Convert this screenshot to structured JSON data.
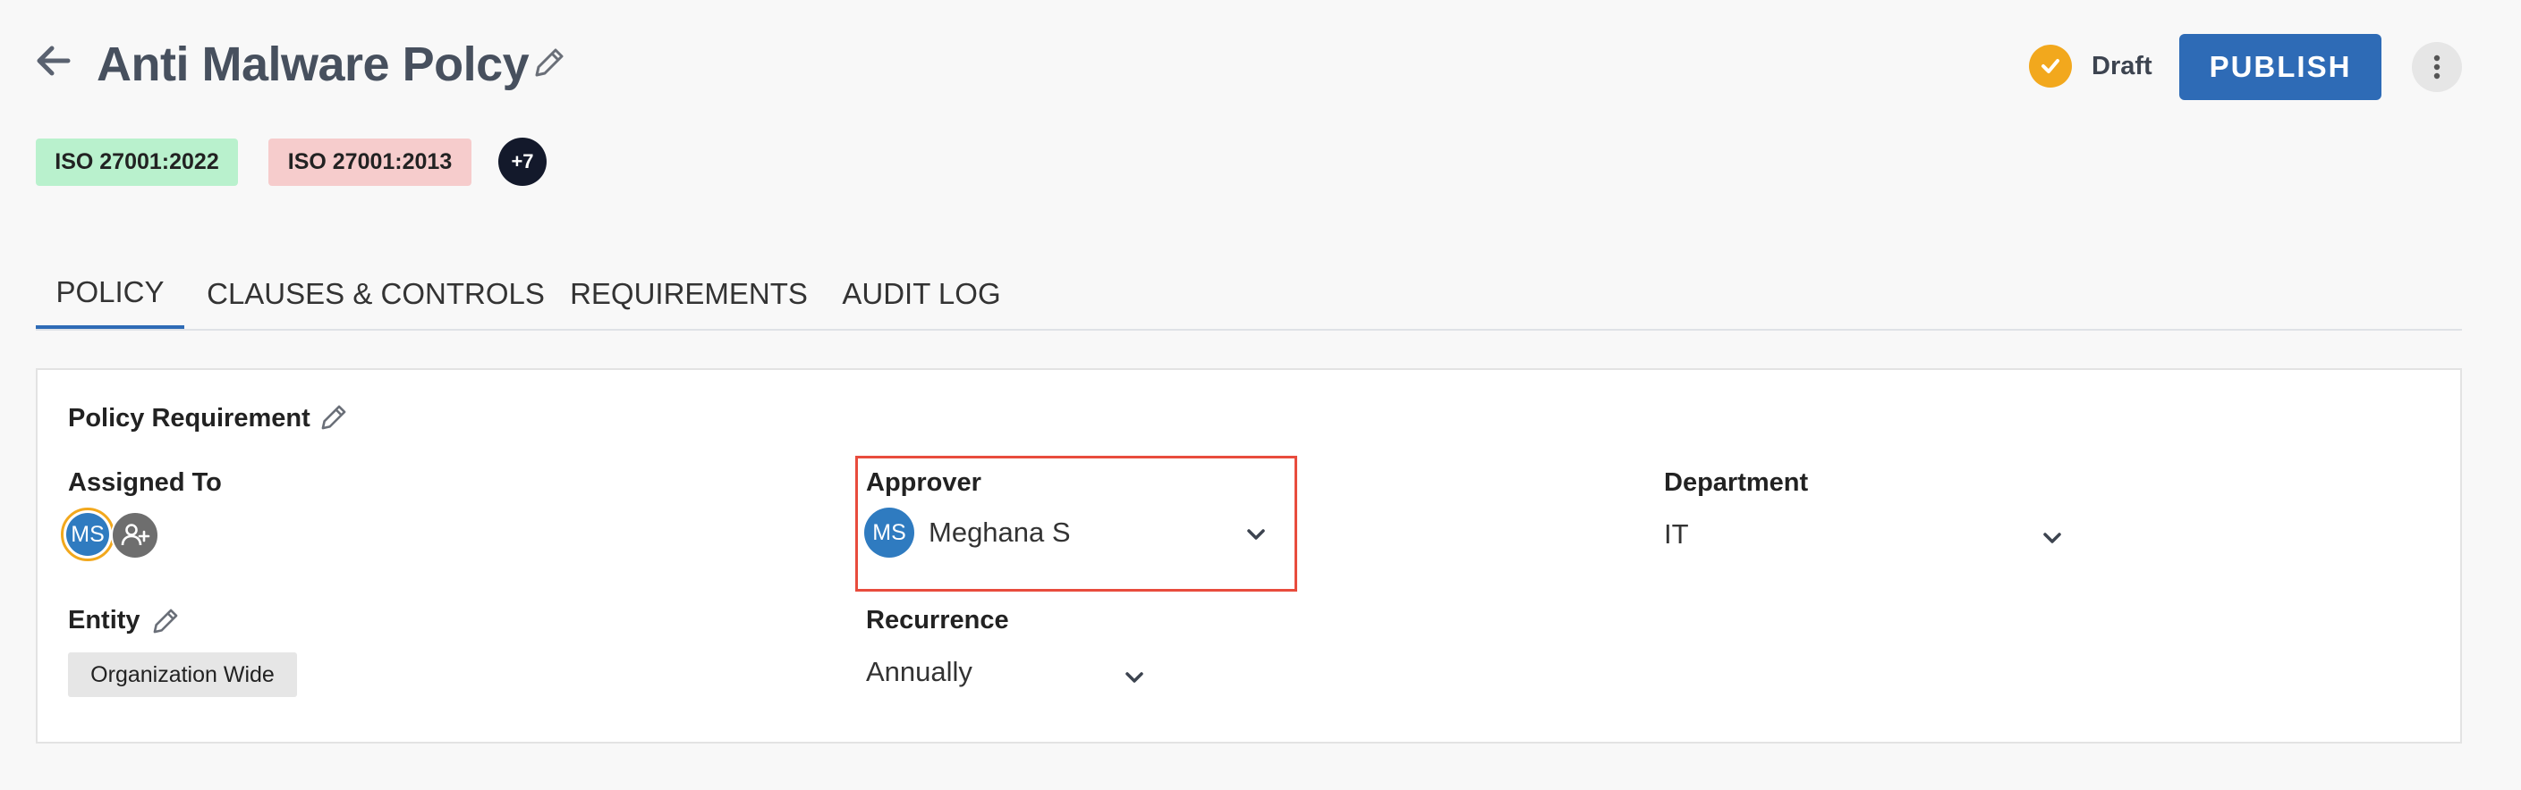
{
  "header": {
    "title": "Anti Malware Polcy",
    "status_label": "Draft",
    "publish_label": "PUBLISH"
  },
  "tags": {
    "items": [
      {
        "label": "ISO 27001:2022",
        "color": "#b9f1cd"
      },
      {
        "label": "ISO 27001:2013",
        "color": "#f6cccc"
      }
    ],
    "more_label": "+7"
  },
  "tabs": [
    {
      "label": "POLICY",
      "active": true
    },
    {
      "label": "CLAUSES & CONTROLS",
      "active": false
    },
    {
      "label": "REQUIREMENTS",
      "active": false
    },
    {
      "label": "AUDIT LOG",
      "active": false
    }
  ],
  "card": {
    "title": "Policy Requirement",
    "assigned_to": {
      "label": "Assigned To",
      "avatar_initials": "MS"
    },
    "approver": {
      "label": "Approver",
      "avatar_initials": "MS",
      "value": "Meghana S"
    },
    "department": {
      "label": "Department",
      "value": "IT"
    },
    "entity": {
      "label": "Entity",
      "value": "Organization Wide"
    },
    "recurrence": {
      "label": "Recurrence",
      "value": "Annually"
    }
  },
  "colors": {
    "accent": "#2e6bb6",
    "status": "#f2a81d",
    "highlight": "#e84c3d",
    "avatar": "#2f7bc0"
  },
  "icons": {
    "back": "arrow-left-icon",
    "edit": "pencil-icon",
    "status": "check-circle-icon",
    "more": "more-vertical-icon",
    "add_user": "user-plus-icon",
    "dropdown": "chevron-down-icon"
  }
}
